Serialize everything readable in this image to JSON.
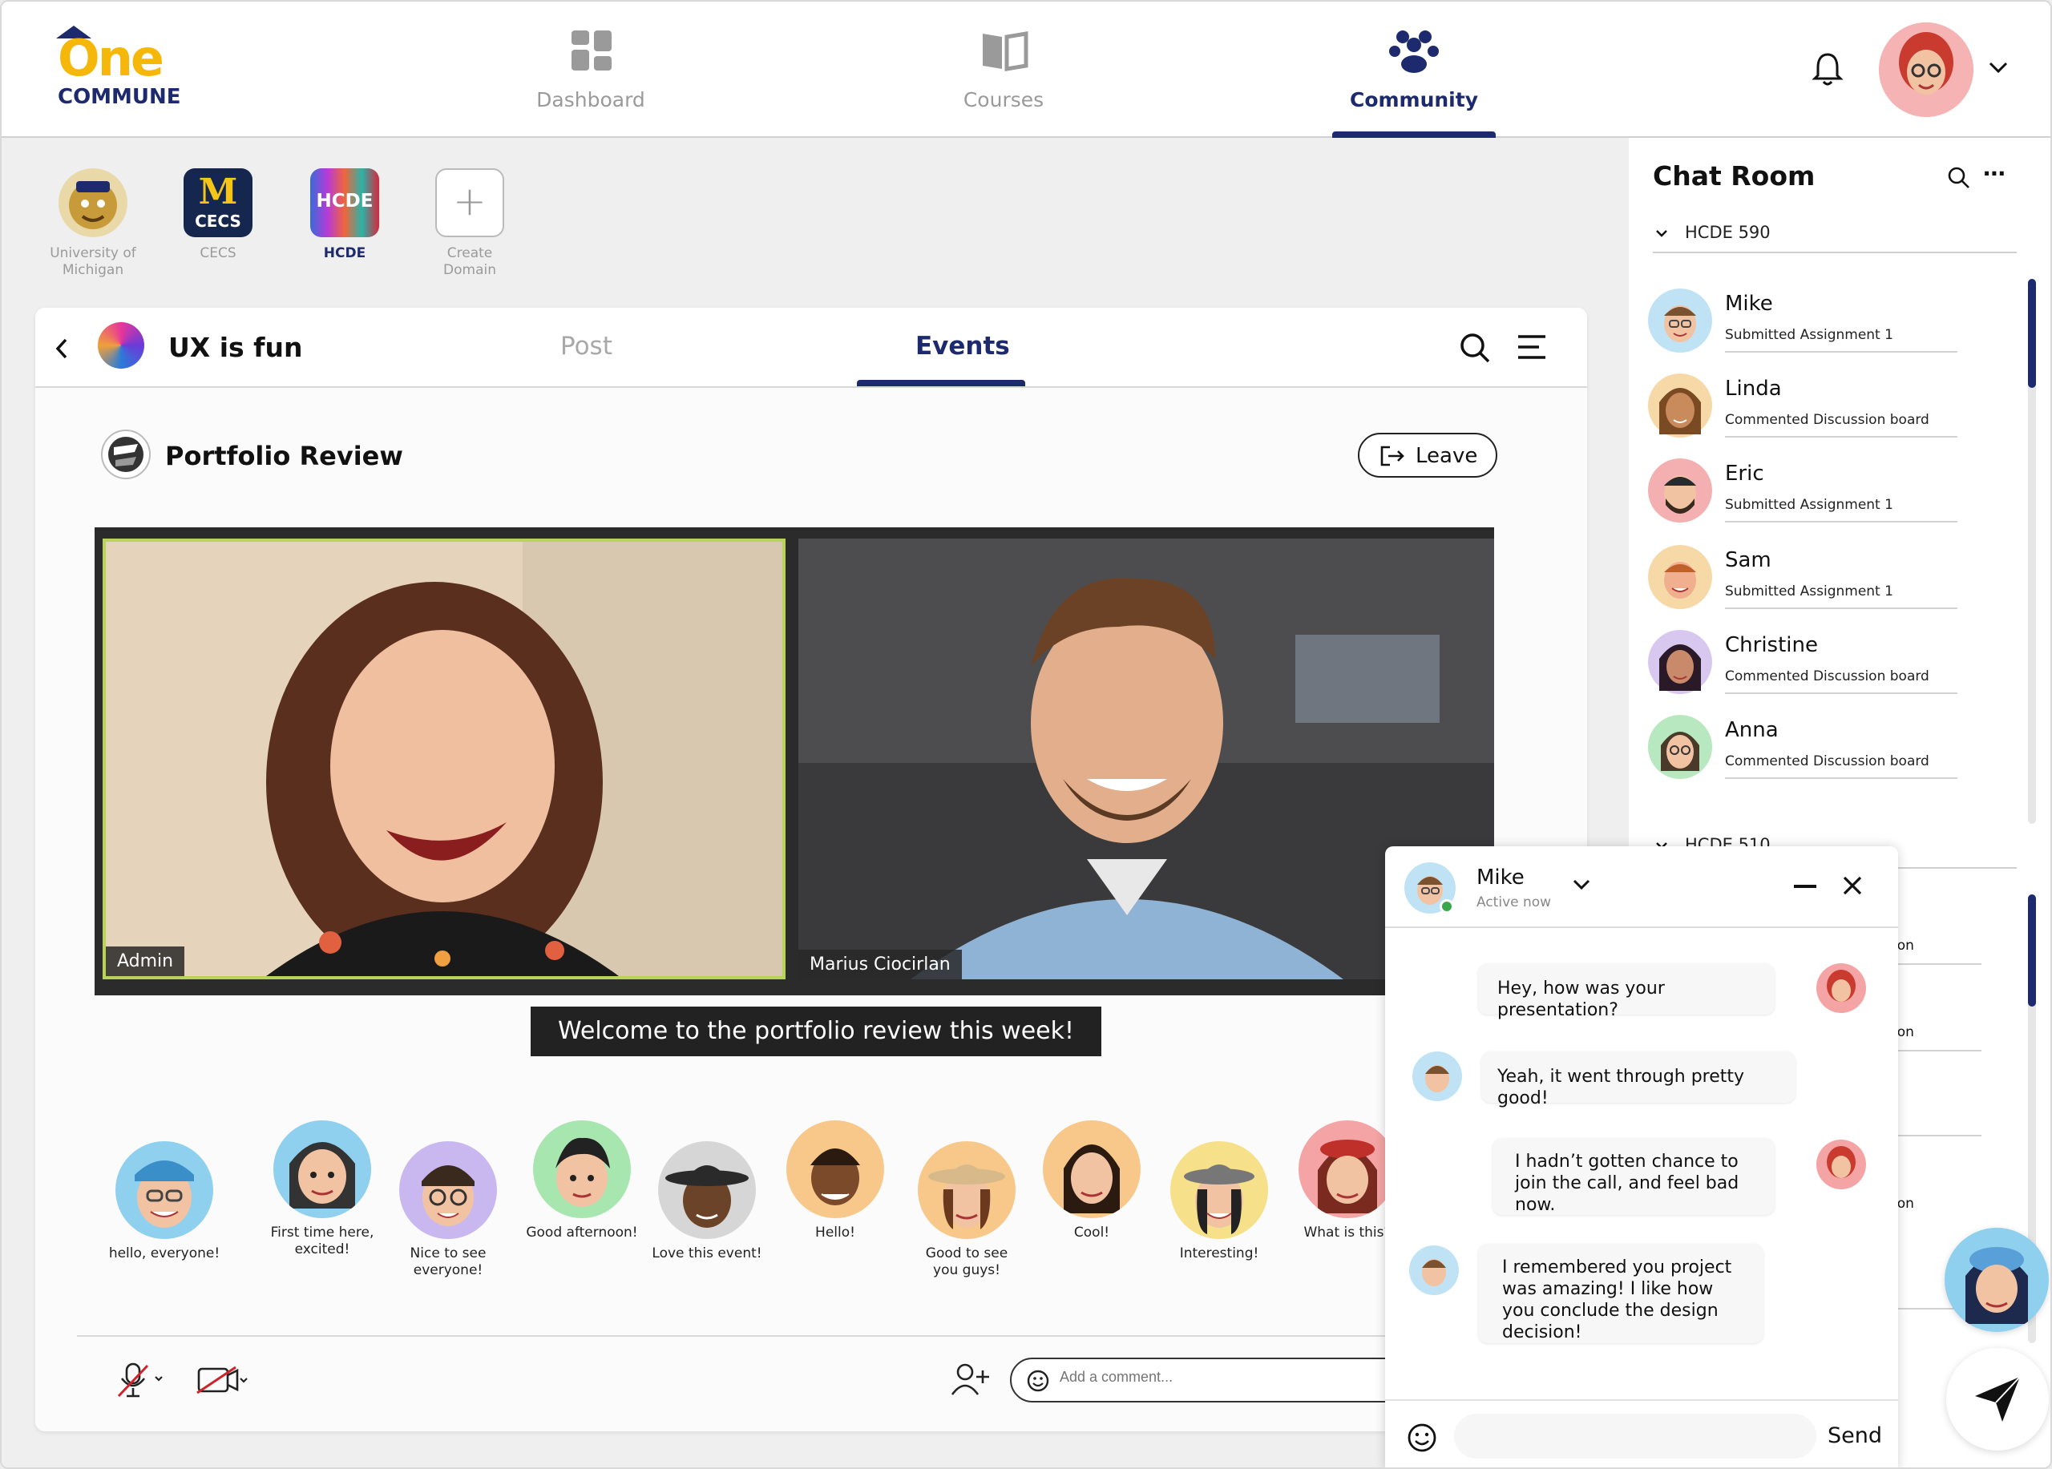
{
  "brand": {
    "name_top": "One",
    "name_bottom": "COMMUNE"
  },
  "nav": {
    "items": [
      {
        "label": "Dashboard",
        "icon": "dashboard-icon"
      },
      {
        "label": "Courses",
        "icon": "book-icon"
      },
      {
        "label": "Community",
        "icon": "community-icon",
        "active": true
      }
    ]
  },
  "domains": [
    {
      "label": "University of Michigan",
      "icon_text": ""
    },
    {
      "label": "CECS",
      "icon_text": "M"
    },
    {
      "label": "HCDE",
      "icon_text": "HCDE",
      "active": true
    },
    {
      "label": "Create Domain",
      "icon_text": "+"
    }
  ],
  "group": {
    "name": "UX is fun",
    "tabs": [
      "Post",
      "Events"
    ],
    "active_tab": "Events"
  },
  "event": {
    "title": "Portfolio Review",
    "leave_label": "Leave",
    "video_labels": [
      "Admin",
      "Marius Ciocirlan"
    ],
    "caption": "Welcome to the portfolio review this week!"
  },
  "reactions": [
    {
      "text": "hello, everyone!"
    },
    {
      "text": "First time here, excited!"
    },
    {
      "text": "Nice to see everyone!"
    },
    {
      "text": "Good afternoon!"
    },
    {
      "text": "Love this event!"
    },
    {
      "text": "Hello!"
    },
    {
      "text": "Good to see you guys!"
    },
    {
      "text": "Cool!"
    },
    {
      "text": "Interesting!"
    },
    {
      "text": "What is this?"
    }
  ],
  "comment": {
    "placeholder": "Add a comment..."
  },
  "chat_room": {
    "title": "Chat Room",
    "group1": "HCDE 590",
    "group2": "HCDE 510",
    "members": [
      {
        "name": "Mike",
        "status": "Submitted Assignment 1"
      },
      {
        "name": "Linda",
        "status": "Commented Discussion board"
      },
      {
        "name": "Eric",
        "status": "Submitted Assignment 1"
      },
      {
        "name": "Sam",
        "status": "Submitted Assignment 1"
      },
      {
        "name": "Christine",
        "status": "Commented Discussion board"
      },
      {
        "name": "Anna",
        "status": "Commented Discussion board"
      }
    ],
    "hidden_partial": [
      "ion",
      "ion",
      "ion"
    ]
  },
  "chat_popup": {
    "name": "Mike",
    "presence": "Active now",
    "messages": [
      {
        "from": "me",
        "text": "Hey, how was your presentation?"
      },
      {
        "from": "mike",
        "text": "Yeah, it went through pretty good!"
      },
      {
        "from": "me",
        "text": "I hadn’t gotten chance to join the call, and feel bad now."
      },
      {
        "from": "mike",
        "text": "I remembered you project was amazing! I like how you conclude the design decision!"
      }
    ],
    "send_label": "Send"
  },
  "colors": {
    "brand_navy": "#1d2a6e",
    "brand_yellow": "#f5b80a",
    "speaker_border": "#b9d25a"
  }
}
